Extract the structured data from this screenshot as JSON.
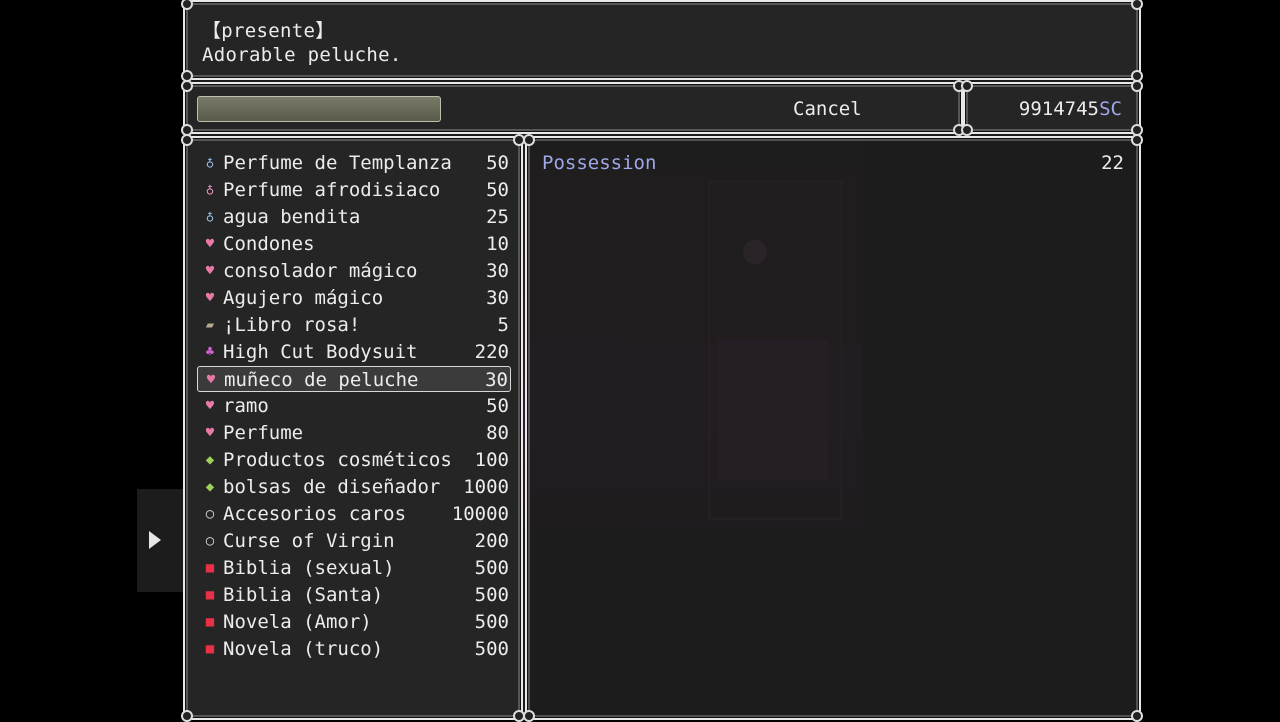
{
  "help": {
    "line1": "【presente】",
    "line2": "Adorable peluche."
  },
  "command": {
    "cancel_label": "Cancel"
  },
  "gold": {
    "amount": "9914745",
    "unit": "SC"
  },
  "items": [
    {
      "name": "Perfume de Templanza",
      "price": "50",
      "icon": "bottle-blue-icon",
      "glyph": "♁"
    },
    {
      "name": "Perfume afrodisiaco",
      "price": "50",
      "icon": "bottle-pink-icon",
      "glyph": "♁"
    },
    {
      "name": "agua bendita",
      "price": "25",
      "icon": "bottle-blue-icon",
      "glyph": "♁"
    },
    {
      "name": "Condones",
      "price": "10",
      "icon": "pink-bag-icon",
      "glyph": "♥"
    },
    {
      "name": "consolador mágico",
      "price": "30",
      "icon": "pink-bag-icon",
      "glyph": "♥"
    },
    {
      "name": "Agujero mágico",
      "price": "30",
      "icon": "pink-bag-icon",
      "glyph": "♥"
    },
    {
      "name": "¡Libro rosa!",
      "price": "5",
      "icon": "book-icon",
      "glyph": "▰"
    },
    {
      "name": "High Cut Bodysuit",
      "price": "220",
      "icon": "bodysuit-icon",
      "glyph": "♣"
    },
    {
      "name": "muñeco de peluche",
      "price": "30",
      "icon": "pink-bag-icon",
      "glyph": "♥"
    },
    {
      "name": "ramo",
      "price": "50",
      "icon": "pink-bag-icon",
      "glyph": "♥"
    },
    {
      "name": "Perfume",
      "price": "80",
      "icon": "pink-bag-icon",
      "glyph": "♥"
    },
    {
      "name": "Productos cosméticos",
      "price": "100",
      "icon": "green-bag-icon",
      "glyph": "◆"
    },
    {
      "name": "bolsas de diseñador",
      "price": "1000",
      "icon": "green-bag-icon",
      "glyph": "◆"
    },
    {
      "name": "Accesorios caros",
      "price": "10000",
      "icon": "necklace-icon",
      "glyph": "○"
    },
    {
      "name": "Curse of Virgin",
      "price": "200",
      "icon": "necklace-icon",
      "glyph": "○"
    },
    {
      "name": "Biblia (sexual)",
      "price": "500",
      "icon": "red-book-icon",
      "glyph": "■"
    },
    {
      "name": "Biblia (Santa)",
      "price": "500",
      "icon": "red-book-icon",
      "glyph": "■"
    },
    {
      "name": "Novela (Amor)",
      "price": "500",
      "icon": "red-book-icon",
      "glyph": "■"
    },
    {
      "name": "Novela (truco)",
      "price": "500",
      "icon": "red-book-icon",
      "glyph": "■"
    }
  ],
  "selected_index": 8,
  "status": {
    "possession_label": "Possession",
    "possession_value": "22"
  },
  "colors": {
    "system_blue": "#9ea8e8",
    "window_border": "#e8e8e8"
  }
}
